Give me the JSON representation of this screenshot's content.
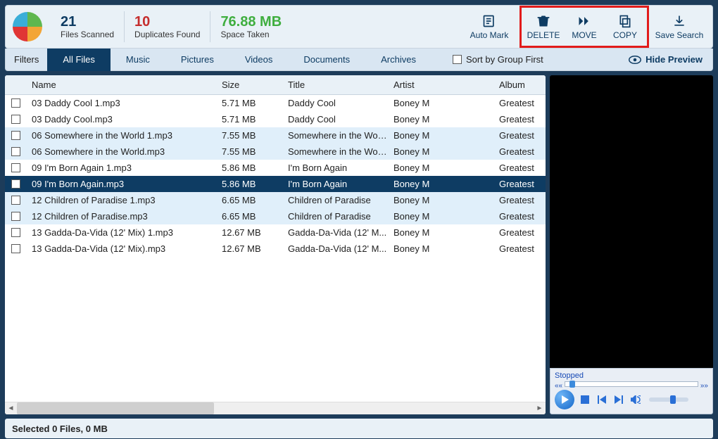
{
  "stats": {
    "scanned_num": "21",
    "scanned_lbl": "Files Scanned",
    "dupes_num": "10",
    "dupes_lbl": "Duplicates Found",
    "space_num": "76.88 MB",
    "space_lbl": "Space Taken"
  },
  "topbuttons": {
    "automark": "Auto Mark",
    "delete": "DELETE",
    "move": "MOVE",
    "copy": "COPY",
    "save": "Save Search"
  },
  "filter": {
    "label": "Filters",
    "tabs": [
      "All Files",
      "Music",
      "Pictures",
      "Videos",
      "Documents",
      "Archives"
    ],
    "sort": "Sort by Group First",
    "hide": "Hide Preview"
  },
  "columns": {
    "c1": "Name",
    "c2": "Size",
    "c3": "Title",
    "c4": "Artist",
    "c5": "Album"
  },
  "rows": [
    {
      "name": "03 Daddy Cool 1.mp3",
      "size": "5.71 MB",
      "title": "Daddy Cool",
      "artist": "Boney M",
      "album": "Greatest",
      "alt": false,
      "sel": false
    },
    {
      "name": "03 Daddy Cool.mp3",
      "size": "5.71 MB",
      "title": "Daddy Cool",
      "artist": "Boney M",
      "album": "Greatest",
      "alt": false,
      "sel": false
    },
    {
      "name": "06 Somewhere in the World 1.mp3",
      "size": "7.55 MB",
      "title": "Somewhere in the Wor...",
      "artist": "Boney M",
      "album": "Greatest",
      "alt": true,
      "sel": false
    },
    {
      "name": "06 Somewhere in the World.mp3",
      "size": "7.55 MB",
      "title": "Somewhere in the Wor...",
      "artist": "Boney M",
      "album": "Greatest",
      "alt": true,
      "sel": false
    },
    {
      "name": "09 I'm Born Again 1.mp3",
      "size": "5.86 MB",
      "title": "I'm Born Again",
      "artist": "Boney M",
      "album": "Greatest",
      "alt": false,
      "sel": false
    },
    {
      "name": "09 I'm Born Again.mp3",
      "size": "5.86 MB",
      "title": "I'm Born Again",
      "artist": "Boney M",
      "album": "Greatest",
      "alt": false,
      "sel": true
    },
    {
      "name": "12 Children of Paradise 1.mp3",
      "size": "6.65 MB",
      "title": "Children of Paradise",
      "artist": "Boney M",
      "album": "Greatest",
      "alt": true,
      "sel": false
    },
    {
      "name": "12 Children of Paradise.mp3",
      "size": "6.65 MB",
      "title": "Children of Paradise",
      "artist": "Boney M",
      "album": "Greatest",
      "alt": true,
      "sel": false
    },
    {
      "name": "13 Gadda-Da-Vida (12' Mix) 1.mp3",
      "size": "12.67 MB",
      "title": "Gadda-Da-Vida (12' M...",
      "artist": "Boney M",
      "album": "Greatest",
      "alt": false,
      "sel": false
    },
    {
      "name": "13 Gadda-Da-Vida (12' Mix).mp3",
      "size": "12.67 MB",
      "title": "Gadda-Da-Vida (12' M...",
      "artist": "Boney M",
      "album": "Greatest",
      "alt": false,
      "sel": false
    }
  ],
  "player": {
    "status": "Stopped"
  },
  "status": "Selected 0 Files, 0 MB"
}
